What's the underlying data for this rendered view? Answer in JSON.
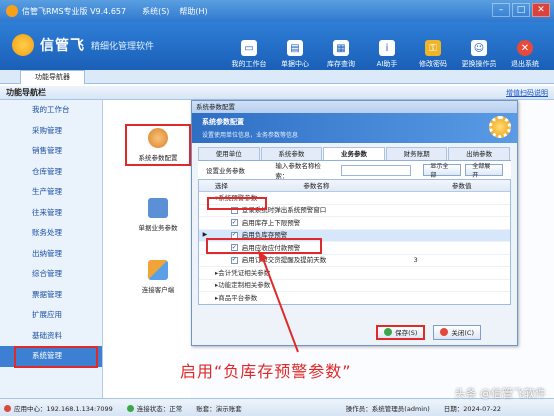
{
  "window": {
    "title": "信管飞RMS专业版 V9.4.657",
    "menus": [
      "系统(S)",
      "帮助(H)"
    ]
  },
  "brand": {
    "name": "信管飞",
    "slogan": "精细化管理软件"
  },
  "toolbar": [
    "我的工作台",
    "单据中心",
    "库存查询",
    "AI助手",
    "修改密码",
    "更换操作员",
    "退出系统"
  ],
  "tabstrip": {
    "tab": "功能导航器"
  },
  "nav": {
    "title": "功能导航栏",
    "link": "增值扫码说明"
  },
  "sidebar": [
    {
      "label": "我的工作台"
    },
    {
      "label": "采购管理"
    },
    {
      "label": "销售管理"
    },
    {
      "label": "仓库管理"
    },
    {
      "label": "生产管理"
    },
    {
      "label": "往来管理"
    },
    {
      "label": "账务处理"
    },
    {
      "label": "出纳管理"
    },
    {
      "label": "综合管理"
    },
    {
      "label": "票据管理"
    },
    {
      "label": "扩展应用"
    },
    {
      "label": "基础资料"
    },
    {
      "label": "系统管理",
      "active": true
    }
  ],
  "middle_tools": [
    "系统参数配置",
    "单据业务参数",
    "连接客户端"
  ],
  "dialog": {
    "title": "系统参数配置",
    "header_title": "系统参数配置",
    "header_subtitle": "设置使用单位信息，业务参数等信息",
    "tabs": [
      "使用单位",
      "系统参数",
      "业务参数",
      "财务账期",
      "出纳参数"
    ],
    "active_tab": 2,
    "search": {
      "label": "设置业务参数",
      "input_label": "输入参数名称检索：",
      "value": "",
      "show_all": "显示全部",
      "expand_all": "全部展开"
    },
    "columns": [
      "选择",
      "参数名称",
      "参数值"
    ],
    "rows": [
      {
        "type": "group",
        "name": "系统预警参数",
        "expanded": true
      },
      {
        "type": "item",
        "checked": false,
        "name": "登录系统时弹出系统预警窗口",
        "value": ""
      },
      {
        "type": "item",
        "checked": true,
        "name": "启用库存上下限预警",
        "value": ""
      },
      {
        "type": "item",
        "checked": true,
        "name": "启用负库存预警",
        "value": "",
        "selected": true
      },
      {
        "type": "item",
        "checked": true,
        "name": "启用应收应付款预警",
        "value": ""
      },
      {
        "type": "item",
        "checked": true,
        "name": "启用订单交货提醒及提前天数",
        "value": "3"
      },
      {
        "type": "group",
        "name": "会计凭证相关参数",
        "expanded": false
      },
      {
        "type": "group",
        "name": "功能定制相关参数",
        "expanded": false
      },
      {
        "type": "group",
        "name": "商品平台参数",
        "expanded": false
      }
    ],
    "buttons": {
      "save": "保存(S)",
      "close": "关闭(C)"
    }
  },
  "caption": "启用“负库存预警参数”",
  "statusbar": [
    "应用中心：192.168.1.134:7099",
    "连接状态：正常",
    "账套：演示账套",
    "操作员：系统管理员(admin)",
    "日期：2024-07-22"
  ],
  "watermark": "头条 @信管飞软件"
}
